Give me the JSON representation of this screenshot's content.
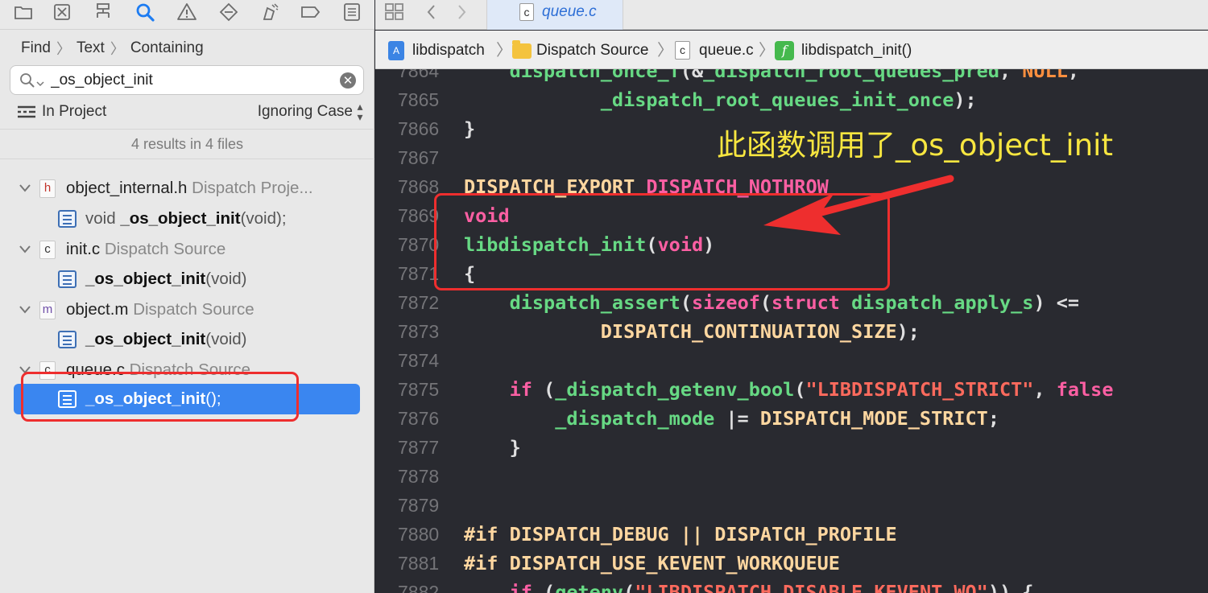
{
  "navigator": {
    "toolbar_icons": [
      "folder-icon",
      "source-control-icon",
      "hierarchy-icon",
      "search-icon",
      "warning-icon",
      "test-icon",
      "debug-icon",
      "breakpoint-icon",
      "report-icon"
    ],
    "find_breadcrumb": [
      "Find",
      "Text",
      "Containing"
    ],
    "search": {
      "value": "_os_object_init",
      "placeholder": ""
    },
    "scope": "In Project",
    "case_mode": "Ignoring Case",
    "results_summary": "4 results in 4 files",
    "files": [
      {
        "type": "h",
        "type_color": "#c2352c",
        "name": "object_internal.h",
        "group": "Dispatch Proje...",
        "match": {
          "prefix": "void ",
          "bold": "_os_object_init",
          "suffix": "(void);"
        }
      },
      {
        "type": "c",
        "type_color": "#333333",
        "name": "init.c",
        "group": "Dispatch Source",
        "match": {
          "prefix": "",
          "bold": "_os_object_init",
          "suffix": "(void)"
        }
      },
      {
        "type": "m",
        "type_color": "#6e4ea8",
        "name": "object.m",
        "group": "Dispatch Source",
        "match": {
          "prefix": "",
          "bold": "_os_object_init",
          "suffix": "(void)"
        }
      },
      {
        "type": "c",
        "type_color": "#333333",
        "name": "queue.c",
        "group": "Dispatch Source",
        "match": {
          "prefix": "",
          "bold": "_os_object_init",
          "suffix": "();"
        }
      }
    ]
  },
  "editor": {
    "tab_title": "queue.c",
    "jumpbar": {
      "project": "libdispatch",
      "group": "Dispatch Source",
      "file": "queue.c",
      "function": "libdispatch_init()"
    },
    "annotation": "此函数调用了_os_object_init",
    "code_lines": [
      {
        "n": "7864",
        "segs": [
          [
            "w",
            "\t"
          ],
          [
            "f",
            "dispatch_once_f"
          ],
          [
            "w",
            "(&"
          ],
          [
            "f",
            "_dispatch_root_queues_pred"
          ],
          [
            "w",
            ", "
          ],
          [
            "m",
            "NULL"
          ],
          [
            "w",
            ",\n"
          ]
        ]
      },
      {
        "n": "7865",
        "segs": [
          [
            "w",
            "            "
          ],
          [
            "f",
            "_dispatch_root_queues_init_once"
          ],
          [
            "w",
            ");"
          ]
        ]
      },
      {
        "n": "7866",
        "segs": [
          [
            "w",
            "}"
          ]
        ]
      },
      {
        "n": "7867",
        "segs": []
      },
      {
        "n": "7868",
        "segs": [
          [
            "p",
            "DISPATCH_EXPORT "
          ],
          [
            "k",
            "DISPATCH_NOTHROW"
          ]
        ]
      },
      {
        "n": "7869",
        "segs": [
          [
            "k",
            "void"
          ]
        ]
      },
      {
        "n": "7870",
        "segs": [
          [
            "f",
            "libdispatch_init"
          ],
          [
            "w",
            "("
          ],
          [
            "k",
            "void"
          ],
          [
            "w",
            ")"
          ]
        ]
      },
      {
        "n": "7871",
        "segs": [
          [
            "w",
            "{"
          ]
        ]
      },
      {
        "n": "7872",
        "segs": [
          [
            "w",
            "    "
          ],
          [
            "f",
            "dispatch_assert"
          ],
          [
            "w",
            "("
          ],
          [
            "k",
            "sizeof"
          ],
          [
            "w",
            "("
          ],
          [
            "k",
            "struct "
          ],
          [
            "f",
            "dispatch_apply_s"
          ],
          [
            "w",
            ") <="
          ]
        ]
      },
      {
        "n": "7873",
        "segs": [
          [
            "w",
            "            "
          ],
          [
            "p",
            "DISPATCH_CONTINUATION_SIZE"
          ],
          [
            "w",
            ");"
          ]
        ]
      },
      {
        "n": "7874",
        "segs": []
      },
      {
        "n": "7875",
        "segs": [
          [
            "w",
            "    "
          ],
          [
            "k",
            "if"
          ],
          [
            "w",
            " ("
          ],
          [
            "f",
            "_dispatch_getenv_bool"
          ],
          [
            "w",
            "("
          ],
          [
            "s",
            "\"LIBDISPATCH_STRICT\""
          ],
          [
            "w",
            ", "
          ],
          [
            "k",
            "false"
          ]
        ]
      },
      {
        "n": "7876",
        "segs": [
          [
            "w",
            "        "
          ],
          [
            "f",
            "_dispatch_mode"
          ],
          [
            "w",
            " |= "
          ],
          [
            "p",
            "DISPATCH_MODE_STRICT"
          ],
          [
            "w",
            ";"
          ]
        ]
      },
      {
        "n": "7877",
        "segs": [
          [
            "w",
            "    }"
          ]
        ]
      },
      {
        "n": "7878",
        "segs": []
      },
      {
        "n": "7879",
        "segs": []
      },
      {
        "n": "7880",
        "segs": [
          [
            "p",
            "#if DISPATCH_DEBUG || DISPATCH_PROFILE"
          ]
        ]
      },
      {
        "n": "7881",
        "segs": [
          [
            "p",
            "#if DISPATCH_USE_KEVENT_WORKQUEUE"
          ]
        ]
      },
      {
        "n": "7882",
        "segs": [
          [
            "w",
            "    "
          ],
          [
            "k",
            "if"
          ],
          [
            "w",
            " ("
          ],
          [
            "f",
            "getenv"
          ],
          [
            "w",
            "("
          ],
          [
            "s",
            "\"LIBDISPATCH_DISABLE_KEVENT_WQ\""
          ],
          [
            "w",
            ")) {"
          ]
        ]
      }
    ]
  }
}
